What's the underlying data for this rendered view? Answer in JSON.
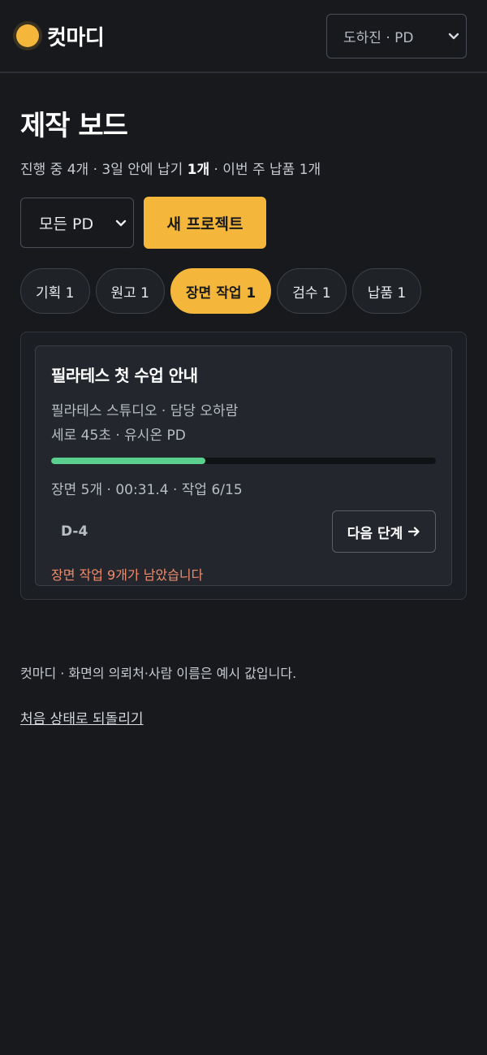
{
  "header": {
    "brand_name": "컷마디",
    "user_select_value": "도하진 · PD"
  },
  "board": {
    "title": "제작 보드",
    "summary_prefix": "진행 중 4개 · 3일 안에 납기 ",
    "summary_bold": "1개",
    "summary_suffix": " · 이번 주 납품 1개"
  },
  "controls": {
    "filter_value": "모든 PD",
    "new_project_label": "새 프로젝트"
  },
  "tabs": [
    {
      "label": "기획 1",
      "active": false
    },
    {
      "label": "원고 1",
      "active": false
    },
    {
      "label": "장면 작업 1",
      "active": true
    },
    {
      "label": "검수 1",
      "active": false
    },
    {
      "label": "납품 1",
      "active": false
    }
  ],
  "card": {
    "title": "필라테스 첫 수업 안내",
    "client_line": "필라테스 스튜디오 · 담당 오하람",
    "format_line": "세로 45초 · 유시온 PD",
    "progress": 0.4,
    "stats": "장면 5개 · 00:31.4 · 작업 6/15",
    "dday": "D-4",
    "next_label": "다음 단계",
    "warning": "장면 작업 9개가 남았습니다"
  },
  "footer": {
    "note": "컷마디 · 화면의 의뢰처·사람 이름은 예시 값입니다.",
    "reset_label": "처음 상태로 되돌리기"
  },
  "colors": {
    "accent": "#f5b73b",
    "progress": "#5bcf8e",
    "warning": "#f28b6b",
    "background": "#17191d"
  },
  "icons": {
    "select_chevron": "chevron-down-icon",
    "next_arrow": "arrow-right-icon"
  }
}
